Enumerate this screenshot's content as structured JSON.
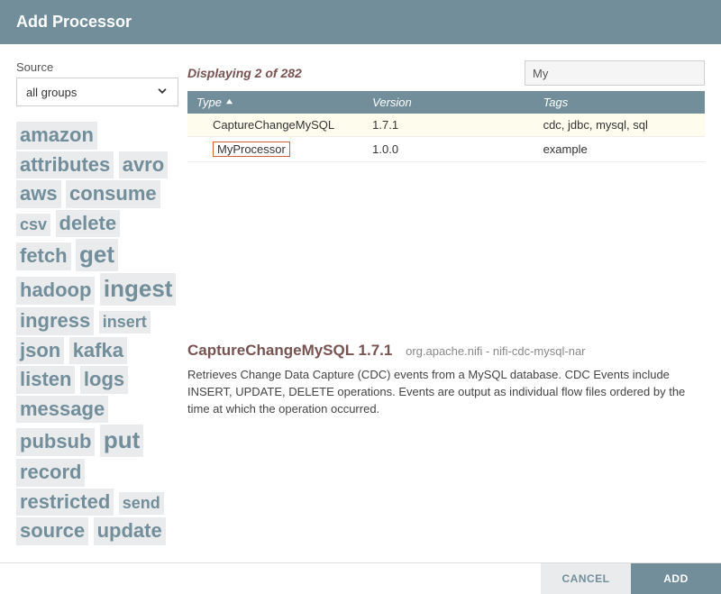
{
  "title": "Add Processor",
  "source_label": "Source",
  "group_select": {
    "value": "all groups"
  },
  "tags": [
    {
      "label": "amazon",
      "size": 3
    },
    {
      "label": "attributes",
      "size": 3
    },
    {
      "label": "avro",
      "size": 3
    },
    {
      "label": "aws",
      "size": 3
    },
    {
      "label": "consume",
      "size": 3
    },
    {
      "label": "csv",
      "size": 2
    },
    {
      "label": "delete",
      "size": 3
    },
    {
      "label": "fetch",
      "size": 3
    },
    {
      "label": "get",
      "size": 4
    },
    {
      "label": "hadoop",
      "size": 3
    },
    {
      "label": "ingest",
      "size": 4
    },
    {
      "label": "ingress",
      "size": 3
    },
    {
      "label": "insert",
      "size": 2
    },
    {
      "label": "json",
      "size": 3
    },
    {
      "label": "kafka",
      "size": 3
    },
    {
      "label": "listen",
      "size": 3
    },
    {
      "label": "logs",
      "size": 3
    },
    {
      "label": "message",
      "size": 3
    },
    {
      "label": "pubsub",
      "size": 3
    },
    {
      "label": "put",
      "size": 4
    },
    {
      "label": "record",
      "size": 3
    },
    {
      "label": "restricted",
      "size": 3
    },
    {
      "label": "send",
      "size": 2
    },
    {
      "label": "source",
      "size": 3
    },
    {
      "label": "update",
      "size": 3
    }
  ],
  "displaying_text": "Displaying 2 of 282",
  "filter_value": "My",
  "columns": {
    "type": "Type",
    "version": "Version",
    "tags": "Tags"
  },
  "rows": [
    {
      "type": "CaptureChangeMySQL",
      "version": "1.7.1",
      "tags": "cdc, jdbc, mysql, sql",
      "selected": true,
      "highlighted": false
    },
    {
      "type": "MyProcessor",
      "version": "1.0.0",
      "tags": "example",
      "selected": false,
      "highlighted": true
    }
  ],
  "detail": {
    "name": "CaptureChangeMySQL 1.7.1",
    "vendor": "org.apache.nifi - nifi-cdc-mysql-nar",
    "description": "Retrieves Change Data Capture (CDC) events from a MySQL database. CDC Events include INSERT, UPDATE, DELETE operations. Events are output as individual flow files ordered by the time at which the operation occurred."
  },
  "buttons": {
    "cancel": "CANCEL",
    "add": "ADD"
  }
}
